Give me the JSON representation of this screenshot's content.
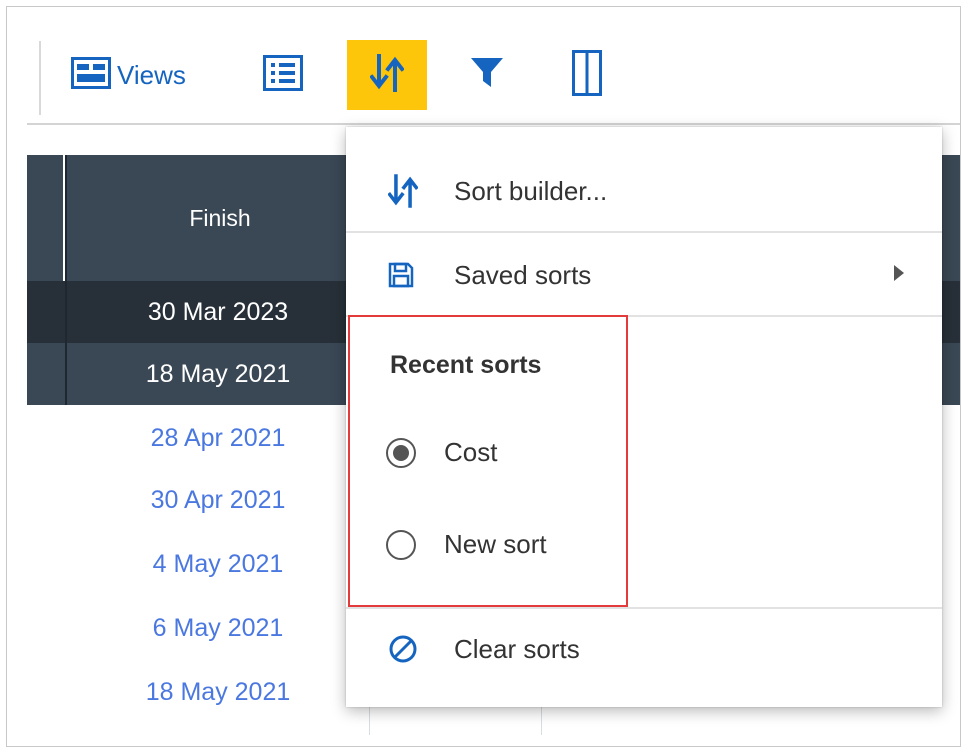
{
  "toolbar": {
    "views_label": "Views",
    "active_color": "#fdc60a",
    "icons": [
      "views-icon",
      "list-icon",
      "sort-icon",
      "filter-icon",
      "columns-icon"
    ]
  },
  "grid": {
    "column_header": "Finish",
    "rows": [
      {
        "finish": "30 Mar 2023",
        "style": "selected-dark"
      },
      {
        "finish": "18 May 2021",
        "style": "selected"
      },
      {
        "finish": "28 Apr 2021",
        "style": "link"
      },
      {
        "finish": "30 Apr 2021",
        "style": "link"
      },
      {
        "finish": "4 May 2021",
        "style": "link"
      },
      {
        "finish": "6 May 2021",
        "style": "link"
      },
      {
        "finish": "18 May 2021",
        "style": "link"
      }
    ]
  },
  "menu": {
    "sort_builder_label": "Sort builder...",
    "saved_sorts_label": "Saved sorts",
    "recent_sorts_title": "Recent sorts",
    "recent_sorts": [
      {
        "label": "Cost",
        "selected": true
      },
      {
        "label": "New sort",
        "selected": false
      }
    ],
    "clear_sorts_label": "Clear sorts",
    "highlight_color": "#e33b3b"
  }
}
